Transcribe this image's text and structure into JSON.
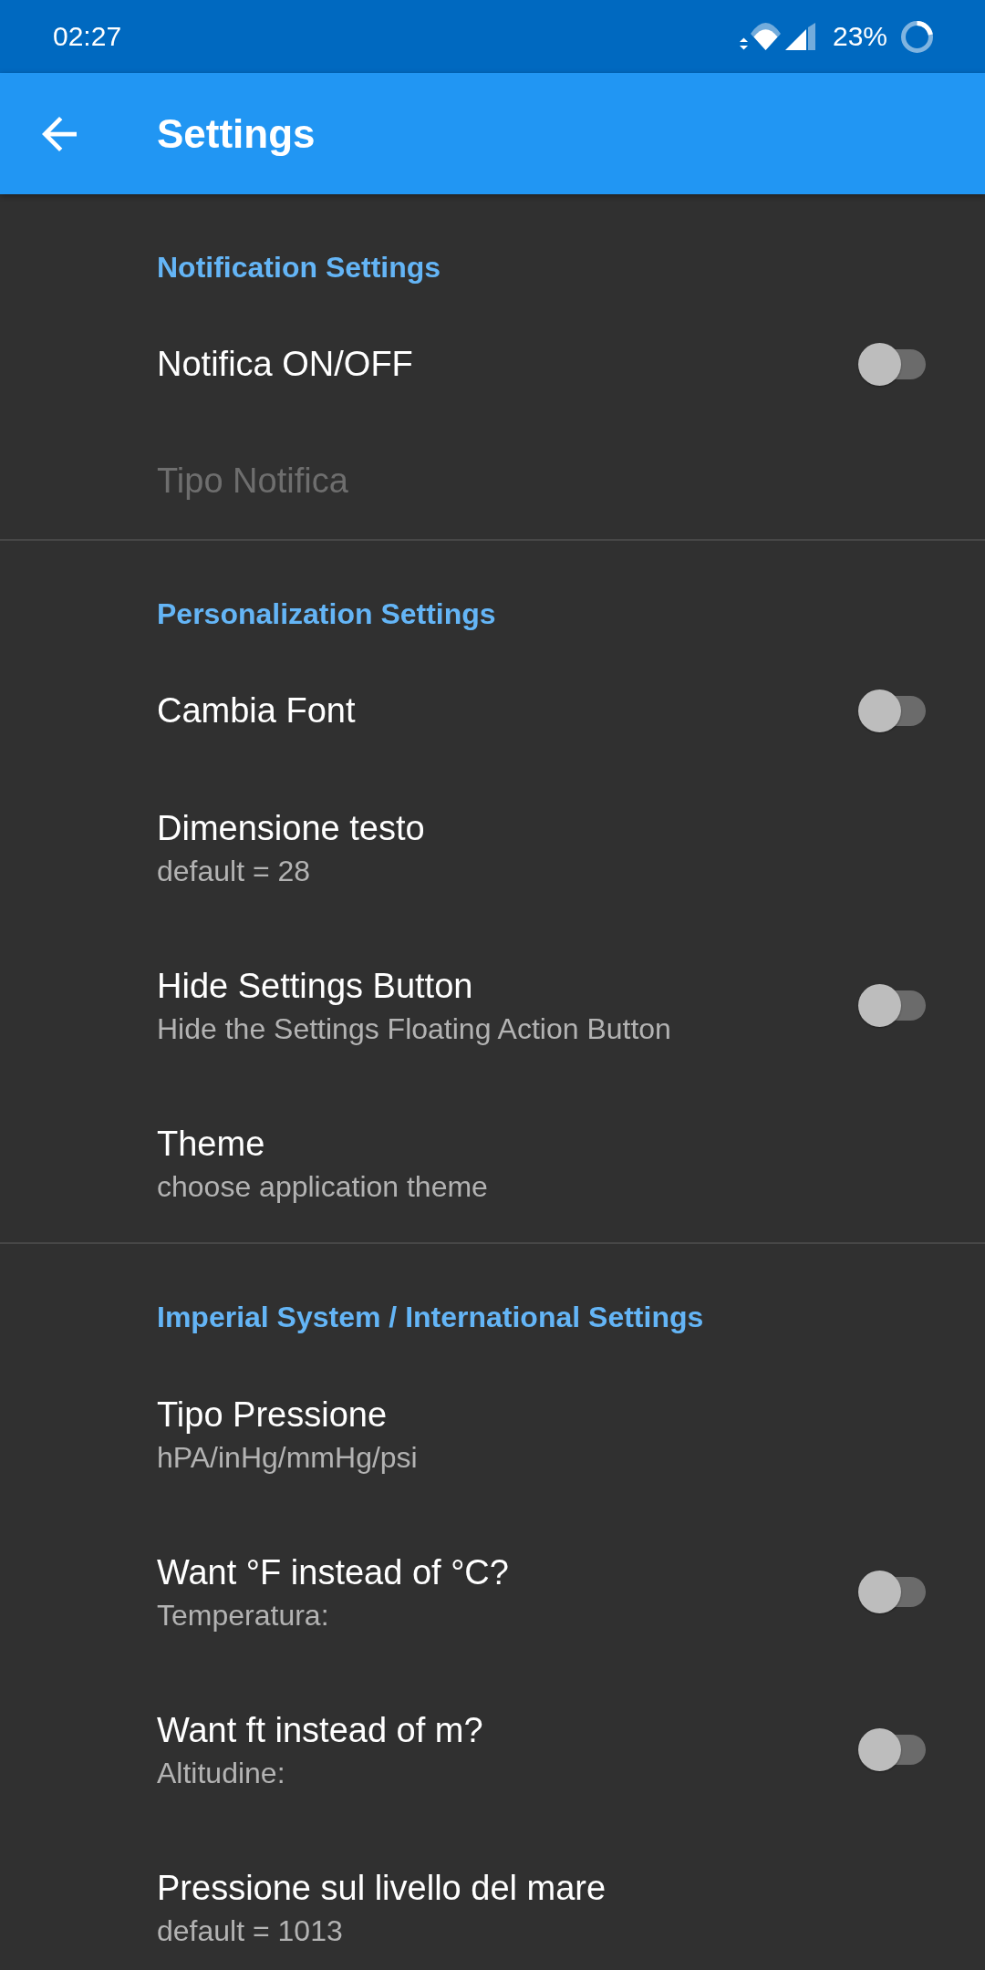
{
  "status_bar": {
    "time": "02:27",
    "battery": "23%"
  },
  "app_bar": {
    "title": "Settings"
  },
  "sections": [
    {
      "title": "Notification Settings",
      "items": [
        {
          "kind": "switch",
          "title": "Notifica ON/OFF",
          "on": false,
          "disabled": false
        },
        {
          "kind": "text",
          "title": "Tipo Notifica",
          "disabled": true
        }
      ]
    },
    {
      "title": "Personalization Settings",
      "items": [
        {
          "kind": "switch",
          "title": "Cambia Font",
          "on": false,
          "disabled": false
        },
        {
          "kind": "text",
          "title": "Dimensione testo",
          "summary": "default = 28",
          "disabled": false
        },
        {
          "kind": "switch",
          "title": "Hide Settings Button",
          "summary": "Hide the Settings Floating Action Button",
          "on": false,
          "disabled": false
        },
        {
          "kind": "text",
          "title": "Theme",
          "summary": "choose application theme",
          "disabled": false
        }
      ]
    },
    {
      "title": "Imperial System / International Settings",
      "items": [
        {
          "kind": "text",
          "title": "Tipo Pressione",
          "summary": "hPA/inHg/mmHg/psi",
          "disabled": false
        },
        {
          "kind": "switch",
          "title": "Want °F instead of °C?",
          "summary": "Temperatura:",
          "on": false,
          "disabled": false
        },
        {
          "kind": "switch",
          "title": "Want ft instead of m?",
          "summary": "Altitudine:",
          "on": false,
          "disabled": false
        },
        {
          "kind": "text",
          "title": "Pressione sul livello del mare",
          "summary": "default = 1013",
          "disabled": false
        }
      ]
    }
  ]
}
